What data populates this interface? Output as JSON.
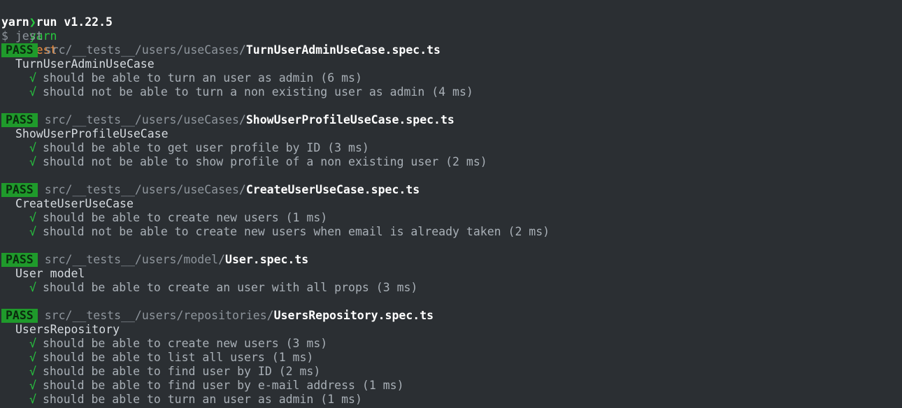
{
  "terminal": {
    "command": {
      "arrow": "❯",
      "yarn": "yarn",
      "arg": "test"
    },
    "version_line": "yarn run v1.22.5",
    "exec_line": "$ jest"
  },
  "suites": [
    {
      "badge": "PASS",
      "path_prefix": "src/__tests__/users/useCases/",
      "file": "TurnUserAdminUseCase.spec.ts",
      "describe": "TurnUserAdminUseCase",
      "tests": [
        "should be able to turn an user as admin (6 ms)",
        "should not be able to turn a non existing user as admin (4 ms)"
      ]
    },
    {
      "badge": "PASS",
      "path_prefix": "src/__tests__/users/useCases/",
      "file": "ShowUserProfileUseCase.spec.ts",
      "describe": "ShowUserProfileUseCase",
      "tests": [
        "should be able to get user profile by ID (3 ms)",
        "should not be able to show profile of a non existing user (2 ms)"
      ]
    },
    {
      "badge": "PASS",
      "path_prefix": "src/__tests__/users/useCases/",
      "file": "CreateUserUseCase.spec.ts",
      "describe": "CreateUserUseCase",
      "tests": [
        "should be able to create new users (1 ms)",
        "should not be able to create new users when email is already taken (2 ms)"
      ]
    },
    {
      "badge": "PASS",
      "path_prefix": "src/__tests__/users/model/",
      "file": "User.spec.ts",
      "describe": "User model",
      "tests": [
        "should be able to create an user with all props (3 ms)"
      ]
    },
    {
      "badge": "PASS",
      "path_prefix": "src/__tests__/users/repositories/",
      "file": "UsersRepository.spec.ts",
      "describe": "UsersRepository",
      "tests": [
        "should be able to create new users (3 ms)",
        "should be able to list all users (1 ms)",
        "should be able to find user by ID (2 ms)",
        "should be able to find user by e-mail address (1 ms)",
        "should be able to turn an user as admin (1 ms)"
      ]
    }
  ],
  "icons": {
    "check": "√"
  },
  "colors": {
    "background": "#2b2f33",
    "pass_badge": "#1f9a2b",
    "check": "#27c93f",
    "command": "#f08d3c"
  }
}
